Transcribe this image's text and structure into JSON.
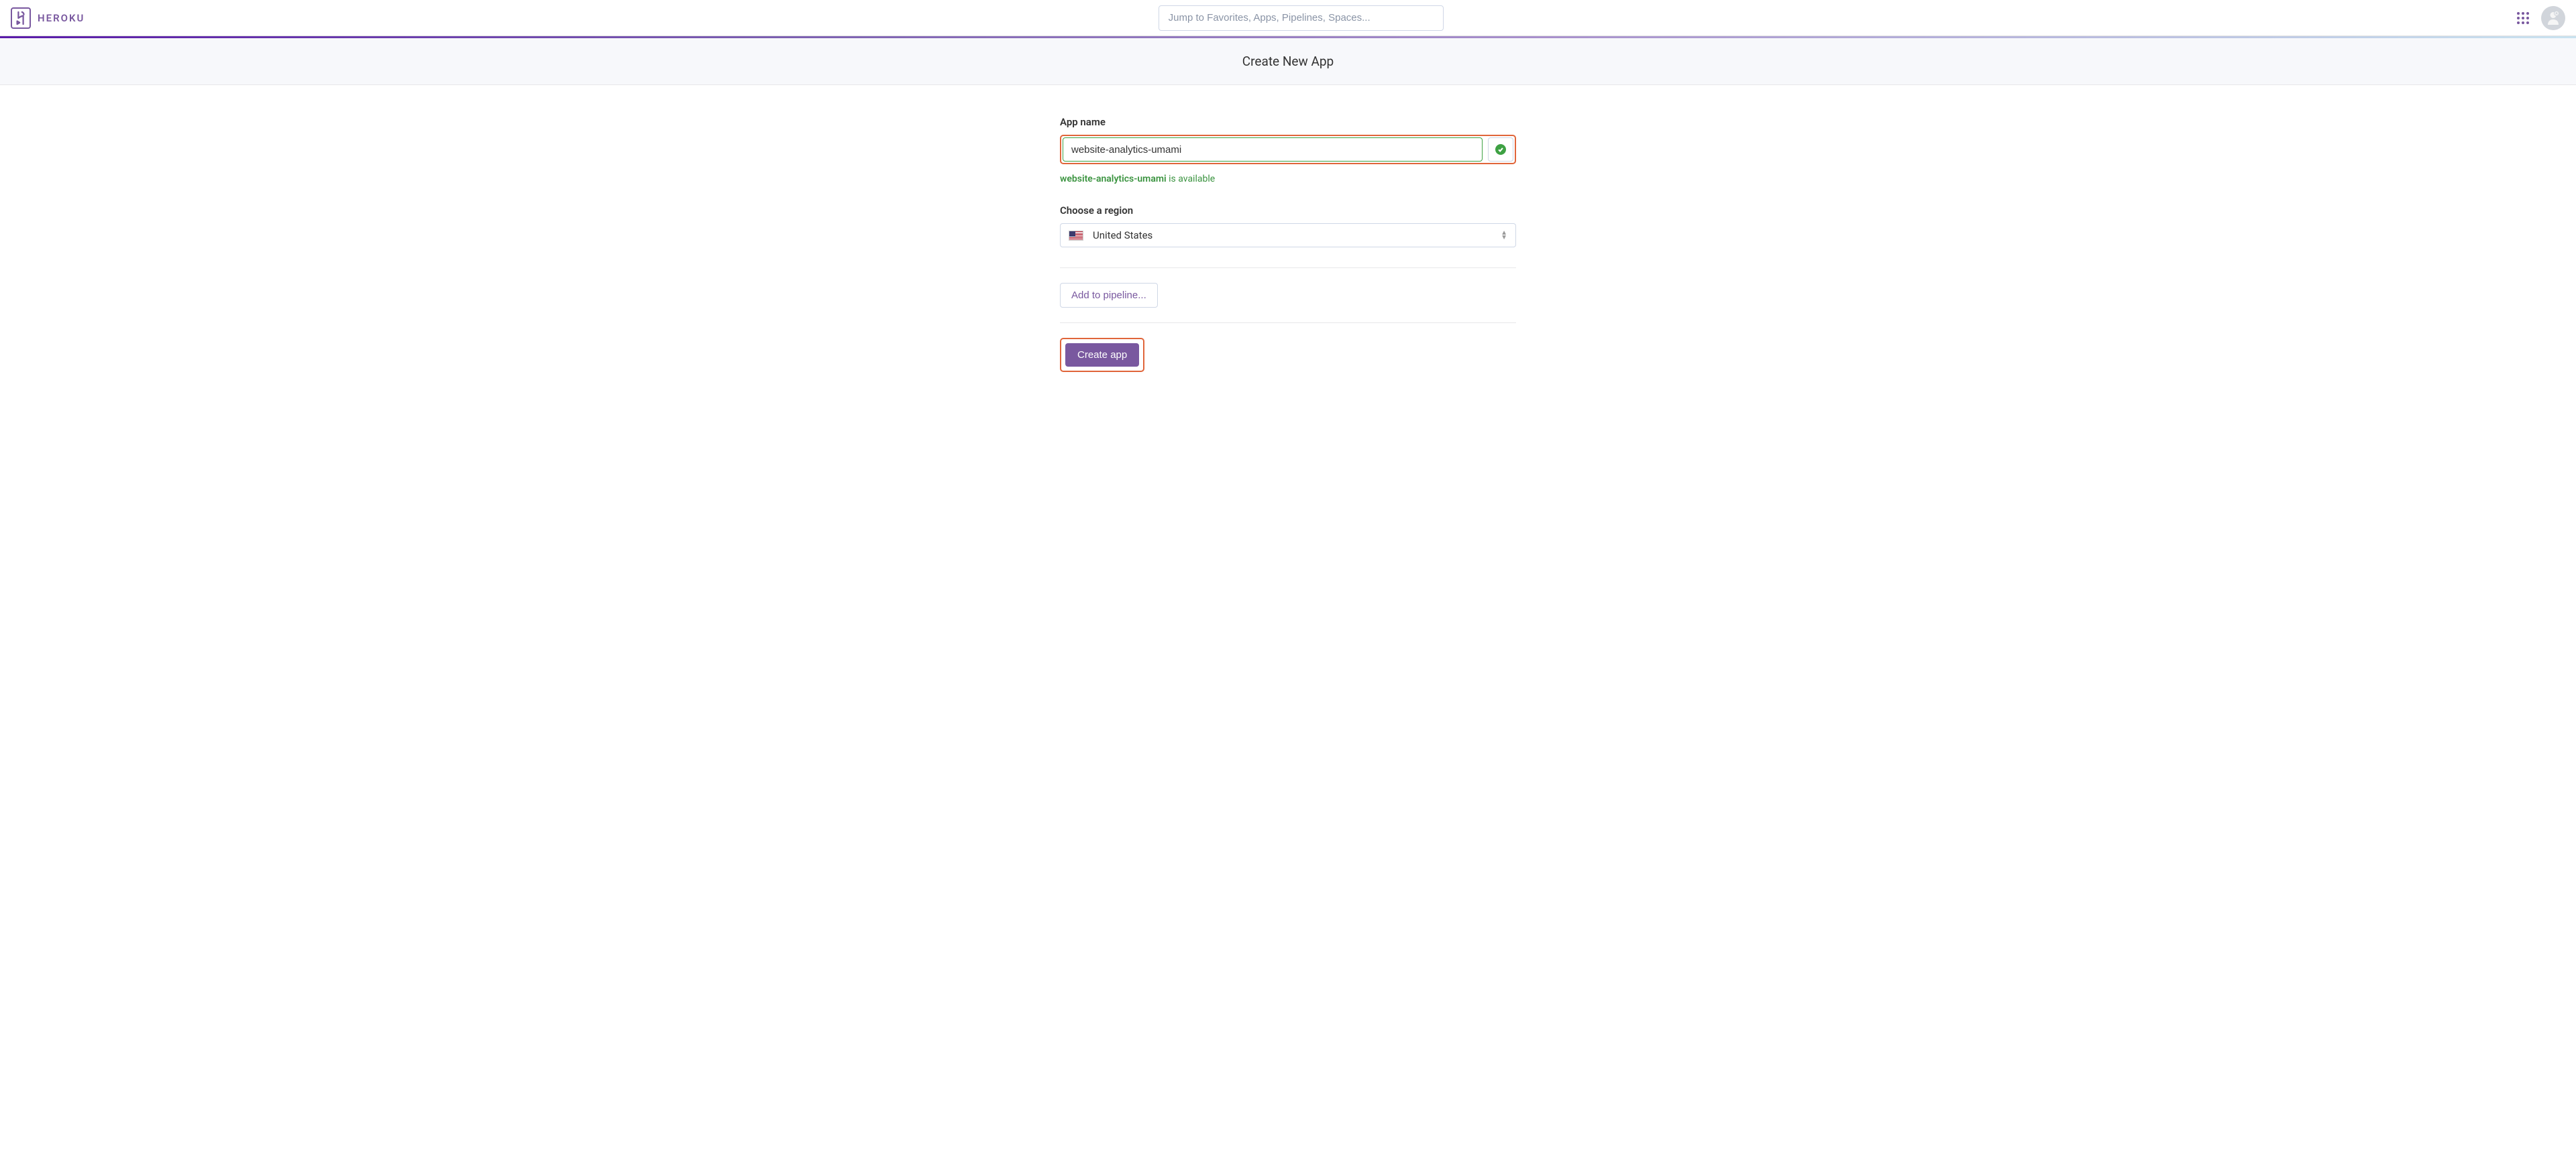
{
  "header": {
    "logo_text": "HEROKU",
    "search_placeholder": "Jump to Favorites, Apps, Pipelines, Spaces..."
  },
  "page": {
    "title": "Create New App"
  },
  "form": {
    "app_name_label": "App name",
    "app_name_value": "website-analytics-umami",
    "availability_name": "website-analytics-umami",
    "availability_suffix": " is available",
    "region_label": "Choose a region",
    "region_selected": "United States",
    "add_pipeline_label": "Add to pipeline...",
    "create_app_label": "Create app"
  }
}
